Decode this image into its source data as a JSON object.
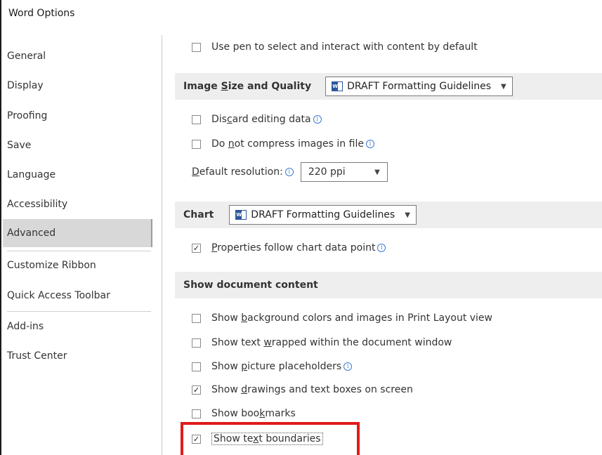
{
  "window": {
    "title": "Word Options"
  },
  "sidebar": {
    "items": [
      {
        "label": "General"
      },
      {
        "label": "Display"
      },
      {
        "label": "Proofing"
      },
      {
        "label": "Save"
      },
      {
        "label": "Language"
      },
      {
        "label": "Accessibility"
      },
      {
        "label": "Advanced",
        "active": true
      },
      {
        "label": "Customize Ribbon"
      },
      {
        "label": "Quick Access Toolbar"
      },
      {
        "label": "Add-ins"
      },
      {
        "label": "Trust Center"
      }
    ]
  },
  "content": {
    "pen_option": {
      "label": "Use pen to select and interact with content by default",
      "checked": false
    },
    "image_section": {
      "title_pre": "Image ",
      "title_key": "S",
      "title_post": "ize and Quality",
      "document": "DRAFT Formatting Guidelines",
      "discard": {
        "pre": "Dis",
        "key": "c",
        "post": "ard editing data",
        "checked": false
      },
      "compress": {
        "pre": "Do ",
        "key": "n",
        "post": "ot compress images in file",
        "checked": false
      },
      "resolution": {
        "pre": "",
        "key": "D",
        "post": "efault resolution:",
        "value": "220 ppi"
      }
    },
    "chart_section": {
      "title": "Chart",
      "document": "DRAFT Formatting Guidelines",
      "properties": {
        "pre": "",
        "key": "P",
        "post": "roperties follow chart data point",
        "checked": true
      }
    },
    "show_section": {
      "title": "Show document content",
      "options": [
        {
          "pre": "Show ",
          "key": "b",
          "post": "ackground colors and images in Print Layout view",
          "checked": false
        },
        {
          "pre": "Show text ",
          "key": "w",
          "post": "rapped within the document window",
          "checked": false
        },
        {
          "pre": "Show ",
          "key": "p",
          "post": "icture placeholders",
          "checked": false
        },
        {
          "pre": "Show ",
          "key": "d",
          "post": "rawings and text boxes on screen",
          "checked": true
        },
        {
          "pre": "Show boo",
          "key": "k",
          "post": "marks",
          "checked": false
        },
        {
          "pre": "Show te",
          "key": "x",
          "post": "t boundaries",
          "checked": true
        }
      ]
    }
  },
  "icons": {
    "info": "info-icon",
    "dropdown": "chevron-down-icon",
    "document": "word-document-icon",
    "check": "checkmark-icon"
  },
  "colors": {
    "highlight": "#e01b1b",
    "active_nav": "#d8d8d8",
    "section_bg": "#eeeeee"
  }
}
